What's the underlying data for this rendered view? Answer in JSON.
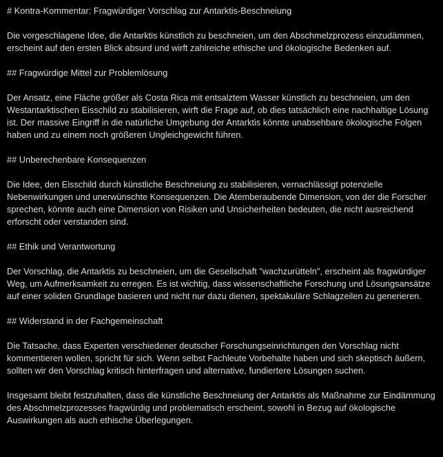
{
  "document": {
    "title": "# Kontra-Kommentar: Fragwürdiger Vorschlag zur Antarktis-Beschneiung",
    "intro": "Die vorgeschlagene Idee, die Antarktis künstlich zu beschneien, um den Abschmelzprozess einzudämmen, erscheint auf den ersten Blick absurd und wirft zahlreiche ethische und ökologische Bedenken auf.",
    "sections": [
      {
        "heading": "## Fragwürdige Mittel zur Problemlösung",
        "text": "Der Ansatz, eine Fläche größer als Costa Rica mit entsalztem Wasser künstlich zu beschneien, um den Westantarktischen Eisschild zu stabilisieren, wirft die Frage auf, ob dies tatsächlich eine nachhaltige Lösung ist. Der massive Eingriff in die natürliche Umgebung der Antarktis könnte unabsehbare ökologische Folgen haben und zu einem noch größeren Ungleichgewicht führen."
      },
      {
        "heading": "## Unberechenbare Konsequenzen",
        "text": "Die Idee, den Eisschild durch künstliche Beschneiung zu stabilisieren, vernachlässigt potenzielle Nebenwirkungen und unerwünschte Konsequenzen. Die Atemberaubende Dimension, von der die Forscher sprechen, könnte auch eine Dimension von Risiken und Unsicherheiten bedeuten, die nicht ausreichend erforscht oder verstanden sind."
      },
      {
        "heading": "## Ethik und Verantwortung",
        "text": "Der Vorschlag, die Antarktis zu beschneien, um die Gesellschaft \"wachzurütteln\", erscheint als fragwürdiger Weg, um Aufmerksamkeit zu erregen. Es ist wichtig, dass wissenschaftliche Forschung und Lösungsansätze auf einer soliden Grundlage basieren und nicht nur dazu dienen, spektakuläre Schlagzeilen zu generieren."
      },
      {
        "heading": "## Widerstand in der Fachgemeinschaft",
        "text": "Die Tatsache, dass Experten verschiedener deutscher Forschungseinrichtungen den Vorschlag nicht kommentieren wollen, spricht für sich. Wenn selbst Fachleute Vorbehalte haben und sich skeptisch äußern, sollten wir den Vorschlag kritisch hinterfragen und alternative, fundiertere Lösungen suchen."
      }
    ],
    "conclusion": "Insgesamt bleibt festzuhalten, dass die künstliche Beschneiung der Antarktis als Maßnahme zur Eindämmung des Abschmelzprozesses fragwürdig und problematisch erscheint, sowohl in Bezug auf ökologische Auswirkungen als auch ethische Überlegungen."
  },
  "colors": {
    "background": "#000000",
    "text": "#dcdcdc"
  }
}
